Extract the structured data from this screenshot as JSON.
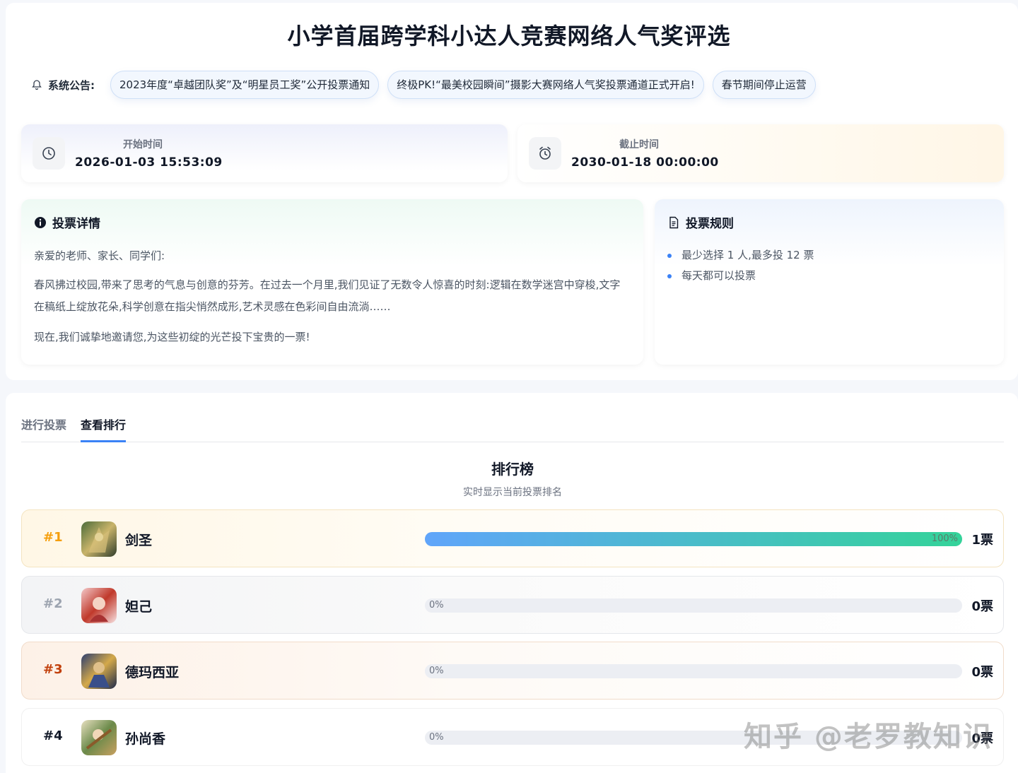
{
  "page": {
    "title": "小学首届跨学科小达人竞赛网络人气奖评选"
  },
  "notice": {
    "label": "系统公告:",
    "items": [
      "2023年度“卓越团队奖”及“明星员工奖”公开投票通知",
      "终极PK!“最美校园瞬间”摄影大赛网络人气奖投票通道正式开启!",
      "春节期间停止运营"
    ]
  },
  "times": {
    "start_label": "开始时间",
    "start_value": "2026-01-03 15:53:09",
    "end_label": "截止时间",
    "end_value": "2030-01-18 00:00:00"
  },
  "details": {
    "title": "投票详情",
    "greeting": "亲爱的老师、家长、同学们:",
    "para1": "春风拂过校园,带来了思考的气息与创意的芬芳。在过去一个月里,我们见证了无数令人惊喜的时刻:逻辑在数学迷宫中穿梭,文字在稿纸上绽放花朵,科学创意在指尖悄然成形,艺术灵感在色彩间自由流淌……",
    "para2": "现在,我们诚挚地邀请您,为这些初绽的光芒投下宝贵的一票!"
  },
  "rules": {
    "title": "投票规则",
    "items": [
      "最少选择 1 人,最多投 12 票",
      "每天都可以投票"
    ]
  },
  "tabs": [
    {
      "label": "进行投票",
      "active": false
    },
    {
      "label": "查看排行",
      "active": true
    }
  ],
  "ranking": {
    "title": "排行榜",
    "subtitle": "实时显示当前投票排名",
    "rows": [
      {
        "rank": "#1",
        "name": "剑圣",
        "pct_text": "100%",
        "pct": 100,
        "votes": "1票"
      },
      {
        "rank": "#2",
        "name": "妲己",
        "pct_text": "0%",
        "pct": 0,
        "votes": "0票"
      },
      {
        "rank": "#3",
        "name": "德玛西亚",
        "pct_text": "0%",
        "pct": 0,
        "votes": "0票"
      },
      {
        "rank": "#4",
        "name": "孙尚香",
        "pct_text": "0%",
        "pct": 0,
        "votes": "0票"
      }
    ]
  },
  "watermark": "知乎 @老罗教知识",
  "colors": {
    "accent": "#3b82f6",
    "gold": "#f59e0b",
    "bronze": "#c2410c"
  }
}
